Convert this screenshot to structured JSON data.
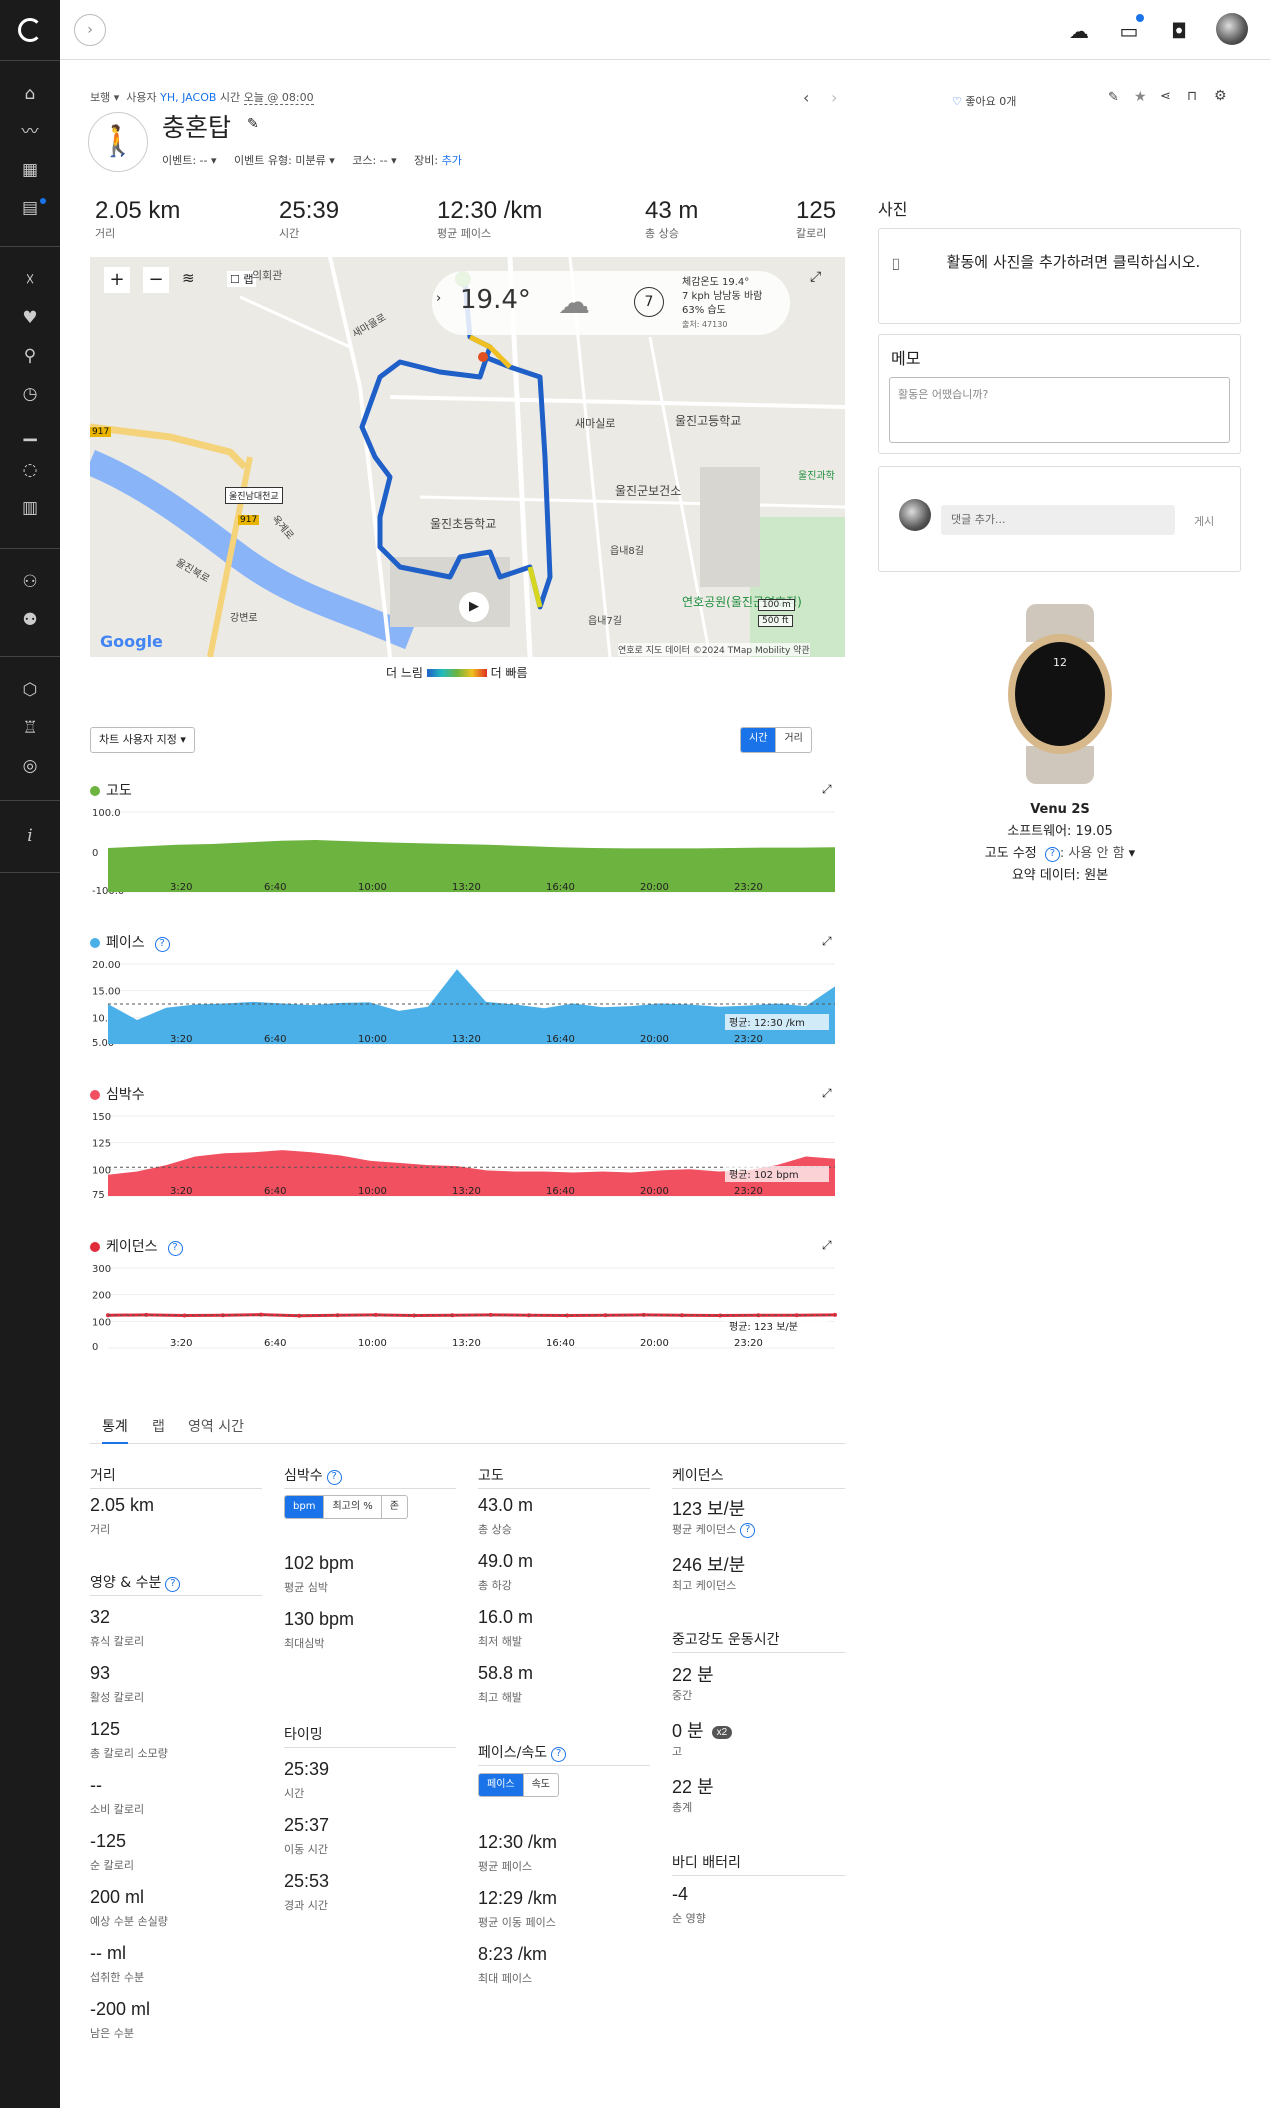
{
  "nav": {
    "back_icon": "chevron-right-icon"
  },
  "topbar": {
    "icons": [
      "upload-cloud-icon",
      "inbox-icon",
      "watch-icon",
      "avatar"
    ]
  },
  "header": {
    "type_label": "보행",
    "user_prefix": "사용자",
    "user_name": "YH, JACOB",
    "time_label": "시간",
    "time_value": "오늘 @ 08:00",
    "title": "충혼탑",
    "event_label": "이벤트: --",
    "event_type_label": "이벤트 유형: 미분류",
    "course_label": "코스: --",
    "equipment_label": "장비:",
    "equipment_link": "추가",
    "likes": "좋아요 0개"
  },
  "stats": [
    {
      "value": "2.05 km",
      "label": "거리"
    },
    {
      "value": "25:39",
      "label": "시간"
    },
    {
      "value": "12:30 /km",
      "label": "평균 페이스"
    },
    {
      "value": "43 m",
      "label": "총 상승"
    },
    {
      "value": "125",
      "label": "칼로리"
    }
  ],
  "map": {
    "zoom_in": "+",
    "zoom_out": "−",
    "lap_label": "랩",
    "temp": "19.4°",
    "wind_dir": "7",
    "weather_lines": [
      "체감온도 19.4°",
      "7 kph 남남동 바람",
      "63% 습도",
      "출처: 47130"
    ],
    "places": [
      "새마실로",
      "울진고등학교",
      "울진군보건소",
      "울진초등학교",
      "읍내8길",
      "읍내7길",
      "연호공원(울진군연호정)",
      "울진남대천교",
      "울진북로",
      "강변로",
      "옥계로",
      "의회관",
      "새마을로",
      "울진과학"
    ],
    "road_badges": [
      "917",
      "917"
    ],
    "scale": [
      "100 m",
      "500 ft"
    ],
    "google": "Google",
    "footer": "연호로  지도 데이터 ©2024 TMap Mobility  약관",
    "legend_slow": "더 느림",
    "legend_fast": "더 빠름"
  },
  "charts_controls": {
    "customize": "차트 사용자 지정 ▾",
    "toggle_time": "시간",
    "toggle_distance": "거리"
  },
  "chart_data": [
    {
      "type": "area",
      "title": "고도",
      "color": "#6cb33f",
      "ylim": [
        -100,
        100
      ],
      "yticks": [
        "100.0",
        "0",
        "-100.0"
      ],
      "x": [
        "3:20",
        "6:40",
        "10:00",
        "13:20",
        "16:40",
        "20:00",
        "23:20"
      ],
      "values": [
        10,
        14,
        18,
        20,
        24,
        28,
        30,
        27,
        24,
        22,
        20,
        18,
        15,
        12,
        10,
        9,
        9,
        9,
        10,
        11,
        11,
        12
      ],
      "avg_label": ""
    },
    {
      "type": "area",
      "title": "페이스",
      "color": "#4bb0e8",
      "ylim": [
        5,
        20
      ],
      "yticks": [
        "5.00",
        "10.00",
        "15.00",
        "20.00"
      ],
      "x": [
        "3:20",
        "6:40",
        "10:00",
        "13:20",
        "16:40",
        "20:00",
        "23:20"
      ],
      "values": [
        12.5,
        9.5,
        11.8,
        12.4,
        12.6,
        12.9,
        12.6,
        12.3,
        12.7,
        12.8,
        11.2,
        12.0,
        19.0,
        12.9,
        12.4,
        11.7,
        12.6,
        11.9,
        12.1,
        12.6,
        12.4,
        12.0,
        12.2,
        12.6,
        12.1,
        15.8
      ],
      "avg_label": "평균: 12:30 /km",
      "avg": 12.5
    },
    {
      "type": "area",
      "title": "심박수",
      "color": "#f0505f",
      "ylim": [
        75,
        150
      ],
      "yticks": [
        "150",
        "125",
        "100",
        "75"
      ],
      "x": [
        "3:20",
        "6:40",
        "10:00",
        "13:20",
        "16:40",
        "20:00",
        "23:20"
      ],
      "values": [
        95,
        98,
        104,
        112,
        115,
        116,
        118,
        116,
        113,
        108,
        106,
        104,
        103,
        99,
        98,
        98,
        97,
        98,
        97,
        99,
        100,
        98,
        99,
        104,
        112,
        110
      ],
      "avg_label": "평균: 102 bpm",
      "avg": 102
    },
    {
      "type": "scatter",
      "title": "케이던스",
      "color": "#e02b3a",
      "ylim": [
        0,
        300
      ],
      "yticks": [
        "300",
        "200",
        "100",
        "0"
      ],
      "x": [
        "3:20",
        "6:40",
        "10:00",
        "13:20",
        "16:40",
        "20:00",
        "23:20"
      ],
      "values": [
        123,
        124,
        122,
        123,
        125,
        121,
        123,
        124,
        122,
        123,
        124,
        123,
        122,
        123,
        124,
        123,
        122,
        123,
        123,
        124
      ],
      "avg_label": "평균: 123 보/분",
      "avg": 123
    }
  ],
  "stats_tabs": [
    "통계",
    "랩",
    "영역 시간"
  ],
  "stats_detail": {
    "distance": {
      "header": "거리",
      "value": "2.05 km",
      "label": "거리"
    },
    "nutrition": {
      "header": "영양 & 수분",
      "items": [
        {
          "v": "32",
          "l": "휴식 칼로리"
        },
        {
          "v": "93",
          "l": "활성 칼로리"
        },
        {
          "v": "125",
          "l": "총 칼로리 소모량"
        },
        {
          "v": "--",
          "l": "소비 칼로리"
        },
        {
          "v": "-125",
          "l": "순 칼로리"
        },
        {
          "v": "200 ml",
          "l": "예상 수분 손실량"
        },
        {
          "v": "-- ml",
          "l": "섭취한 수분"
        },
        {
          "v": "-200 ml",
          "l": "남은 수분"
        }
      ]
    },
    "hr": {
      "header": "심박수",
      "toggle": [
        "bpm",
        "최고의 %",
        "존"
      ],
      "items": [
        {
          "v": "102 bpm",
          "l": "평균 심박"
        },
        {
          "v": "130 bpm",
          "l": "최대심박"
        }
      ]
    },
    "timing": {
      "header": "타이밍",
      "items": [
        {
          "v": "25:39",
          "l": "시간"
        },
        {
          "v": "25:37",
          "l": "이동 시간"
        },
        {
          "v": "25:53",
          "l": "경과 시간"
        }
      ]
    },
    "elevation": {
      "header": "고도",
      "items": [
        {
          "v": "43.0 m",
          "l": "총 상승"
        },
        {
          "v": "49.0 m",
          "l": "총 하강"
        },
        {
          "v": "16.0 m",
          "l": "최저 해발"
        },
        {
          "v": "58.8 m",
          "l": "최고 해발"
        }
      ]
    },
    "pace": {
      "header": "페이스/속도",
      "toggle": [
        "페이스",
        "속도"
      ],
      "items": [
        {
          "v": "12:30 /km",
          "l": "평균 페이스"
        },
        {
          "v": "12:29 /km",
          "l": "평균 이동 페이스"
        },
        {
          "v": "8:23 /km",
          "l": "최대 페이스"
        }
      ]
    },
    "cadence": {
      "header": "케이던스",
      "items": [
        {
          "v": "123 보/분",
          "l": "평균 케이던스"
        },
        {
          "v": "246 보/분",
          "l": "최고 케이던스"
        }
      ]
    },
    "intensity": {
      "header": "중고강도 운동시간",
      "items": [
        {
          "v": "22 분",
          "l": "중간"
        },
        {
          "v": "0 분",
          "l": "고",
          "badge": "x2"
        },
        {
          "v": "22 분",
          "l": "총계"
        }
      ]
    },
    "battery": {
      "header": "바디 배터리",
      "items": [
        {
          "v": "-4",
          "l": "순 영향"
        }
      ]
    }
  },
  "right": {
    "photos_title": "사진",
    "photos_prompt": "활동에 사진을 추가하려면 클릭하십시오.",
    "memo_title": "메모",
    "memo_placeholder": "활동은 어땠습니까?",
    "comment_placeholder": "댓글 추가...",
    "comment_post": "게시",
    "device_name": "Venu 2S",
    "software": "소프트웨어: 19.05",
    "elev_corr_label": "고도 수정",
    "elev_corr_value": ": 사용 안 함",
    "summary": "요약 데이터: 원본",
    "watch_time": "12"
  }
}
